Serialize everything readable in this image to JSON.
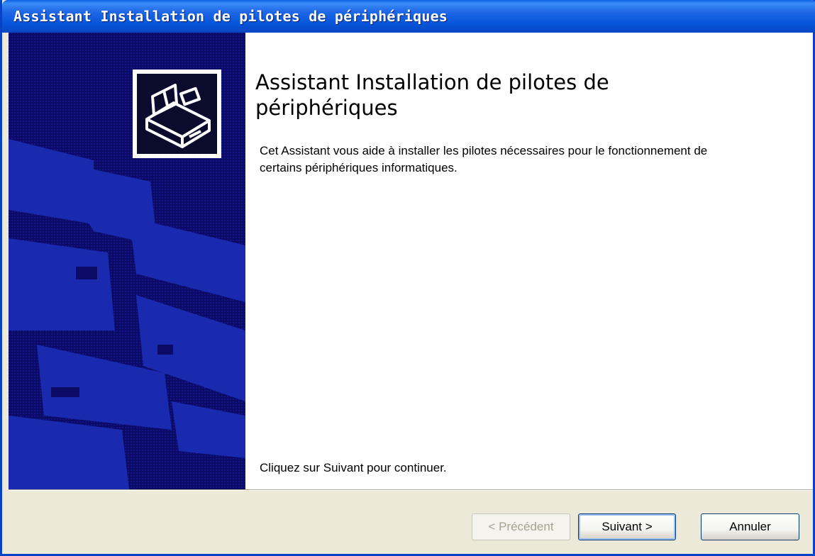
{
  "window": {
    "title": "Assistant Installation de pilotes de périphériques"
  },
  "content": {
    "heading": "Assistant Installation de pilotes de périphériques",
    "description": "Cet Assistant vous aide à installer les pilotes nécessaires pour le fonctionnement de certains périphériques informatiques.",
    "continue_text": "Cliquez sur Suivant pour continuer."
  },
  "buttons": {
    "back_label": "< Précédent",
    "next_label": "Suivant >",
    "cancel_label": "Annuler"
  },
  "colors": {
    "titlebar": "#0A5FEA",
    "banner_bg": "#0B0B66",
    "banner_accent": "#1A2DB0",
    "dialog_bg": "#ECE9D8"
  },
  "icons": {
    "wizard_icon": "hardware-device-icon"
  }
}
